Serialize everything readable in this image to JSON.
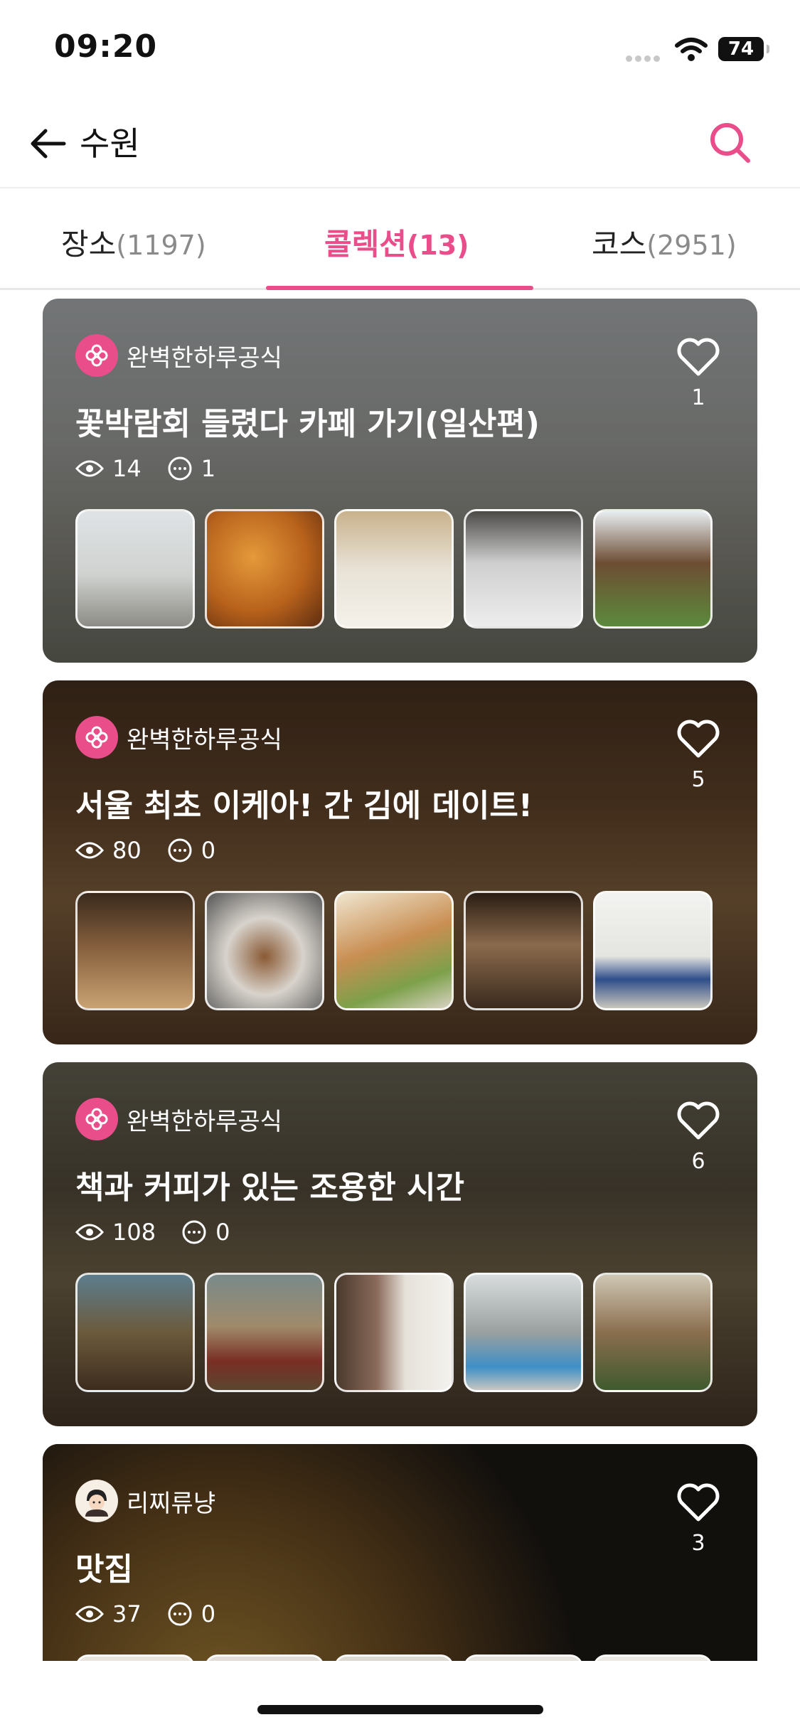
{
  "status_bar": {
    "time": "09:20",
    "battery": "74"
  },
  "header": {
    "title": "수원"
  },
  "tabs": [
    {
      "label": "장소",
      "count": "(1197)"
    },
    {
      "label": "콜렉션",
      "count": "(13)"
    },
    {
      "label": "코스",
      "count": "(2951)"
    }
  ],
  "cards": [
    {
      "author": "완벽한하루공식",
      "title": "꽃박람회 들렸다 카페 가기(일산편)",
      "likes": "1",
      "views": "14",
      "comments": "1"
    },
    {
      "author": "완벽한하루공식",
      "title": "서울 최초 이케아! 간 김에 데이트!",
      "likes": "5",
      "views": "80",
      "comments": "0"
    },
    {
      "author": "완벽한하루공식",
      "title": "책과 커피가 있는 조용한 시간",
      "likes": "6",
      "views": "108",
      "comments": "0"
    },
    {
      "author": "리찌류냥",
      "title": "맛집",
      "likes": "3",
      "views": "37",
      "comments": "0"
    }
  ],
  "colors": {
    "accent": "#e94e8b"
  },
  "icons": {
    "back": "arrow-left-icon",
    "search": "search-icon",
    "like": "heart-icon",
    "views": "eye-icon",
    "comments": "comment-icon"
  }
}
